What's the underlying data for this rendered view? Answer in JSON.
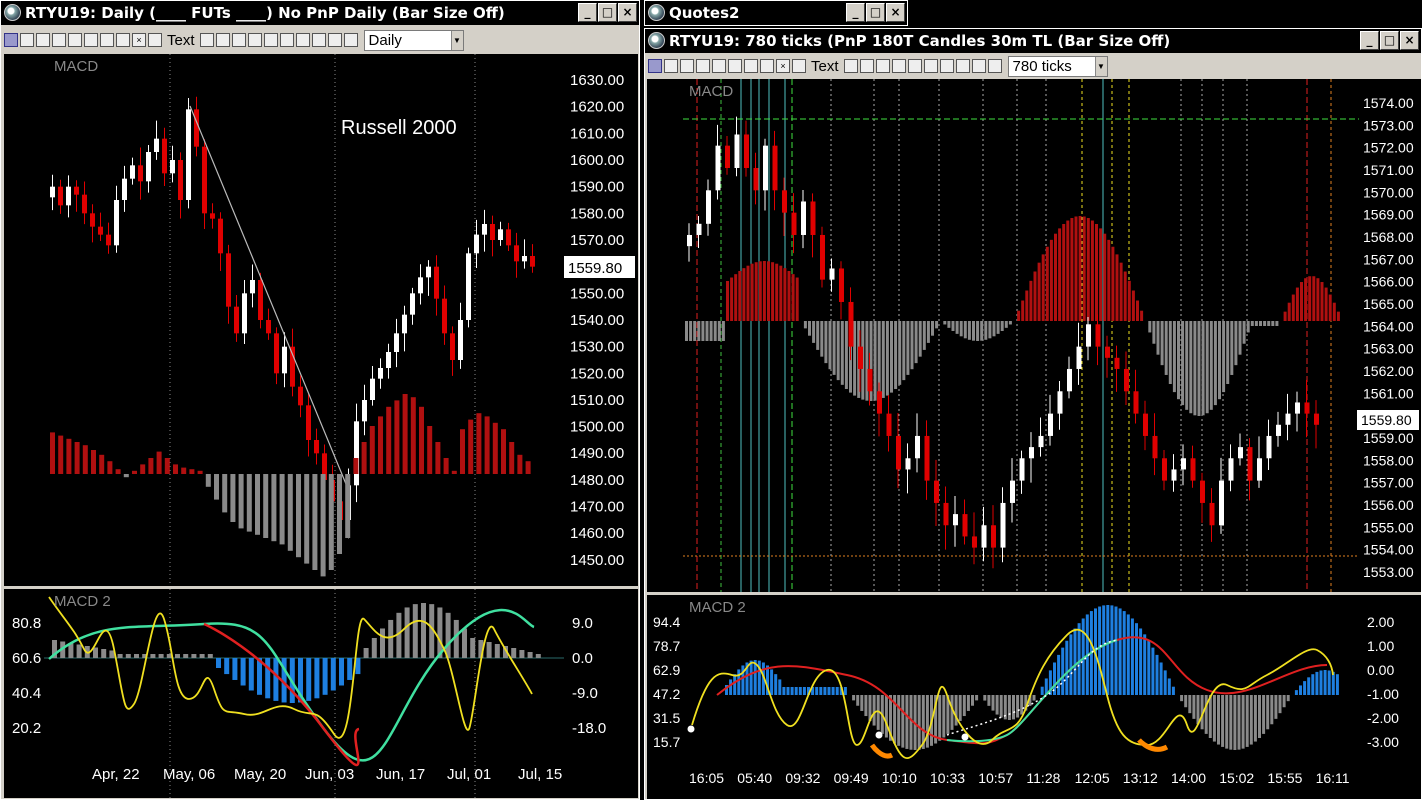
{
  "left_window": {
    "title": "RTYU19: Daily (____ FUTs ____)  No PnP Daily (Bar Size Off)",
    "toolbar": {
      "text_tool": "Text",
      "interval": "Daily"
    },
    "main_panel": {
      "indicator_label": "MACD",
      "annotation": "Russell 2000",
      "price_labels": [
        "1630.00",
        "1620.00",
        "1610.00",
        "1600.00",
        "1590.00",
        "1580.00",
        "1570.00",
        "1560.00",
        "1550.00",
        "1540.00",
        "1530.00",
        "1520.00",
        "1510.00",
        "1500.00",
        "1490.00",
        "1480.00",
        "1470.00",
        "1460.00",
        "1450.00"
      ],
      "last_price": "1559.80"
    },
    "sub_panel": {
      "indicator_label": "MACD 2",
      "left_labels": [
        "80.8",
        "60.6",
        "40.4",
        "20.2"
      ],
      "right_labels": [
        "9.0",
        "0.0",
        "-9.0",
        "-18.0"
      ]
    },
    "date_labels": [
      "Apr, 22",
      "May, 06",
      "May, 20",
      "Jun, 03",
      "Jun, 17",
      "Jul, 01",
      "Jul, 15"
    ]
  },
  "quotes_window": {
    "title": "Quotes2"
  },
  "right_window": {
    "title": "RTYU19: 780 ticks (PnP 180T Candles 30m TL (Bar Size Off)",
    "toolbar": {
      "text_tool": "Text",
      "interval": "780 ticks"
    },
    "main_panel": {
      "indicator_label": "MACD",
      "price_labels": [
        "1574.00",
        "1573.00",
        "1572.00",
        "1571.00",
        "1570.00",
        "1569.00",
        "1568.00",
        "1567.00",
        "1566.00",
        "1565.00",
        "1564.00",
        "1563.00",
        "1562.00",
        "1561.00",
        "1560.00",
        "1559.00",
        "1558.00",
        "1557.00",
        "1556.00",
        "1555.00",
        "1554.00",
        "1553.00"
      ],
      "last_price": "1559.80"
    },
    "sub_panel": {
      "indicator_label": "MACD 2",
      "left_labels": [
        "94.4",
        "78.7",
        "62.9",
        "47.2",
        "31.5",
        "15.7"
      ],
      "right_labels": [
        "2.00",
        "1.00",
        "0.00",
        "-1.00",
        "-2.00",
        "-3.00"
      ]
    },
    "time_labels": [
      "16:05",
      "05:40",
      "09:32",
      "09:49",
      "10:10",
      "10:33",
      "10:57",
      "11:28",
      "12:05",
      "13:12",
      "14:00",
      "15:02",
      "15:55",
      "16:11"
    ]
  },
  "colors": {
    "up": "#ffffff",
    "down": "#e00000",
    "hist_pos": "#b01010",
    "hist_neg": "#8a8a8a",
    "macd_blue": "#1e7fe0",
    "signal_yellow": "#f0e020",
    "green_line": "#40e0a0",
    "red_line": "#e02020"
  }
}
